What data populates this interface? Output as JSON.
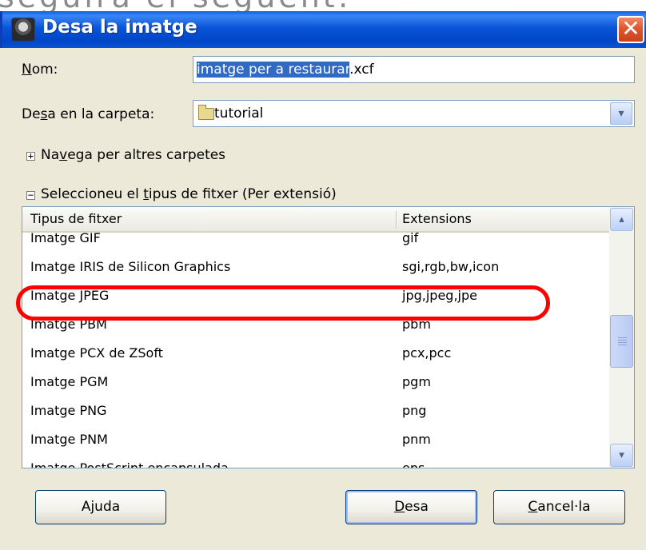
{
  "background_caption": "seguira el següent:",
  "window": {
    "title": "Desa la imatge",
    "close_glyph": "✕",
    "icon": "gimp-icon"
  },
  "name_field": {
    "label_prefix": "",
    "label_ul": "N",
    "label_rest": "om:",
    "selected_part": "imatge per a restaurar",
    "rest": ".xcf"
  },
  "folder": {
    "label_pre": "De",
    "label_ul": "s",
    "label_rest": "a en la carpeta:",
    "value": "tutorial",
    "arrow": "▾"
  },
  "browse_expander": {
    "symbol": "+",
    "pre": "Na",
    "ul": "v",
    "rest": "ega per altres carpetes"
  },
  "type_expander": {
    "symbol": "−",
    "pre": "Seleccioneu el ",
    "ul": "t",
    "rest": "ipus de fitxer (Per extensió)"
  },
  "list": {
    "headers": [
      "Tipus de fitxer",
      "Extensions"
    ],
    "rows": [
      {
        "type": "Imatge GIF",
        "ext": "gif"
      },
      {
        "type": "Imatge IRIS de Silicon Graphics",
        "ext": "sgi,rgb,bw,icon"
      },
      {
        "type": "Imatge JPEG",
        "ext": "jpg,jpeg,jpe"
      },
      {
        "type": "Imatge PBM",
        "ext": "pbm"
      },
      {
        "type": "Imatge PCX de ZSoft",
        "ext": "pcx,pcc"
      },
      {
        "type": "Imatge PGM",
        "ext": "pgm"
      },
      {
        "type": "Imatge PNG",
        "ext": "png"
      },
      {
        "type": "Imatge PNM",
        "ext": "pnm"
      },
      {
        "type": "Imatge PostScript encapsulada",
        "ext": "eps"
      }
    ],
    "scroll_up": "▴",
    "scroll_down": "▾"
  },
  "buttons": {
    "help": "Ajuda",
    "save_ul": "D",
    "save_rest": "esa",
    "cancel_ul": "C",
    "cancel_rest": "ancel·la"
  },
  "colors": {
    "accent": "#316ac5",
    "highlight_ring": "#ff0000",
    "titlebar": "#0a55d8"
  }
}
